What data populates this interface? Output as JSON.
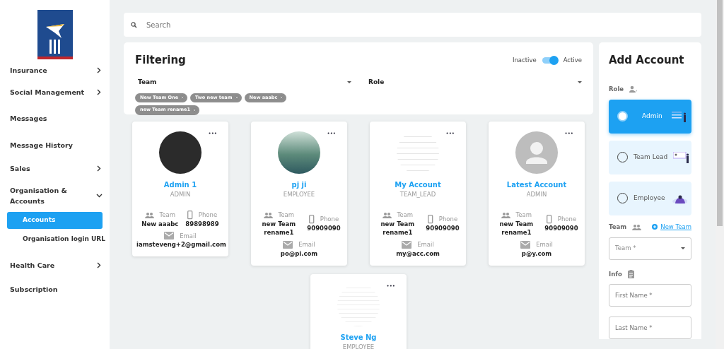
{
  "sidebar": {
    "items": [
      {
        "label": "Insurance",
        "kind": "group",
        "expanded": false
      },
      {
        "label": "Social Management",
        "kind": "group",
        "expanded": false
      },
      {
        "label": "Messages",
        "kind": "link"
      },
      {
        "label": "Message History",
        "kind": "link"
      },
      {
        "label": "Sales",
        "kind": "group",
        "expanded": false
      },
      {
        "label": "Organisation & Accounts",
        "kind": "group",
        "expanded": true,
        "children": [
          {
            "label": "Accounts",
            "selected": true
          },
          {
            "label": "Organisation login URL",
            "selected": false
          }
        ]
      },
      {
        "label": "Health Care",
        "kind": "group",
        "expanded": false
      },
      {
        "label": "Subscription",
        "kind": "link"
      }
    ]
  },
  "search": {
    "placeholder": "Search"
  },
  "filtering": {
    "title": "Filtering",
    "toggle": {
      "off_label": "Inactive",
      "on_label": "Active",
      "on": true
    },
    "filters": [
      {
        "label": "Team",
        "chips": [
          "New Team One",
          "Two new team",
          "New aaabc",
          "new Team rename1"
        ]
      },
      {
        "label": "Role"
      }
    ]
  },
  "accounts": [
    {
      "name": "Admin 1",
      "role": "ADMIN",
      "kind": "photo",
      "team": "New aaabc",
      "phone": "89898989",
      "email": "iamsteveng+2@gmail.com",
      "team_label": "Team",
      "phone_label": "Phone",
      "email_label": "Email",
      "menu": "•••"
    },
    {
      "name": "pj ji",
      "role": "EMPLOYEE",
      "kind": "photo",
      "team": "new Team rename1",
      "phone": "90909090",
      "email": "po@pi.com",
      "team_label": "Team",
      "phone_label": "Phone",
      "email_label": "Email",
      "menu": "•••"
    },
    {
      "name": "My Account",
      "role": "TEAM_LEAD",
      "kind": "photo",
      "team": "new Team rename1",
      "phone": "90909090",
      "email": "my@acc.com",
      "team_label": "Team",
      "phone_label": "Phone",
      "email_label": "Email",
      "menu": "•••"
    },
    {
      "name": "Latest Account",
      "role": "ADMIN",
      "kind": "default",
      "team": "new Team rename1",
      "phone": "90909090",
      "email": "p@y.com",
      "team_label": "Team",
      "phone_label": "Phone",
      "email_label": "Email",
      "menu": "•••"
    },
    {
      "name": "Steve Ng",
      "role": "EMPLOYEE",
      "kind": "photo",
      "menu": "•••"
    }
  ],
  "add_account": {
    "title": "Add Account",
    "role_label": "Role",
    "roles": [
      {
        "label": "Admin",
        "selected": true
      },
      {
        "label": "Team Lead",
        "selected": false
      },
      {
        "label": "Employee",
        "selected": false
      }
    ],
    "team_label": "Team",
    "new_team_link": "New Team",
    "team_select": {
      "placeholder": "Team *"
    },
    "info_label": "Info",
    "fields": [
      {
        "placeholder": "First Name *"
      },
      {
        "placeholder": "Last Name *"
      }
    ]
  }
}
